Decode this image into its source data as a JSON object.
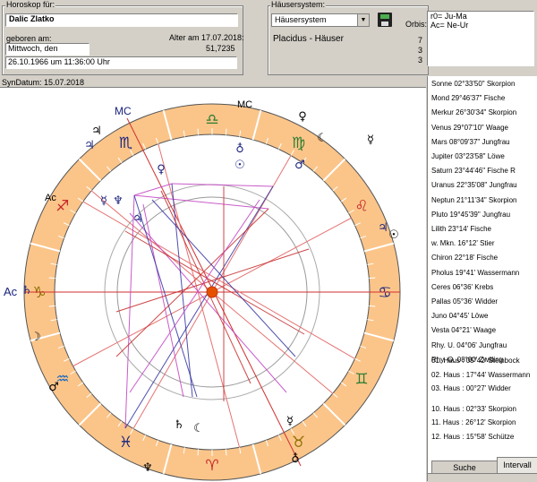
{
  "horoscope": {
    "title": "Horoskop für:",
    "name": "Dalic Zlatko",
    "born_label": "geboren am:",
    "age_label": "Alter am 17.07.2018:",
    "weekday": "Mittwoch, den",
    "age_value": "51,7235",
    "datetime": "26.10.1966  um  11:36:00 Uhr"
  },
  "houses": {
    "title": "Häusersystem:",
    "select_value": "Häusersystem",
    "system_name": "Placidus - Häuser",
    "orbis_label": "Orbis:",
    "orbis_lines": [
      "r0= Ju-Ma",
      "Ac= Ne-Ur"
    ],
    "numbers": [
      "7",
      "3",
      "3"
    ]
  },
  "syn_date": "SynDatum: 15.07.2018",
  "planets": [
    "Sonne    02°33'50\" Skorpion",
    "Mond     29°46'37\" Fische",
    "Merkur   26°30'34\" Skorpion",
    "Venus    29°07'10\" Waage",
    "Mars     08°09'37\" Jungfrau",
    "Jupiter  03°23'58\" Löwe",
    "Saturn   23°44'46\" Fische R",
    "Uranus   22°35'08\" Jungfrau",
    "Neptun   21°11'34\" Skorpion",
    "Pluto    19°45'39\" Jungfrau",
    "Lilith  23°14' Fische",
    "w. Mkn.  16°12' Stier",
    "Chiron   22°18' Fische",
    "Pholus   19°41' Wassermann",
    "Ceres    06°36' Krebs",
    "Pallas   05°36' Widder",
    "Juno     04°45' Löwe",
    "Vesta    04°21' Waage",
    "Rhy. U.    04°06' Jungfrau",
    "Rhy. O.    08°00' Zwilling"
  ],
  "house_cusps": [
    "01. Haus :  05°42' Steinbock",
    "02. Haus :  17°44' Wassermann",
    "03. Haus :  00°27' Widder",
    "10. Haus :  02°33' Skorpion",
    "11. Haus :  26°12' Skorpion",
    "12. Haus :  15°58' Schütze"
  ],
  "tabs": {
    "search": "Suche",
    "interval": "Intervall"
  },
  "chart_labels": {
    "mc": "MC",
    "ac": "Ac"
  },
  "colors": {
    "zodiac_ring": "#fbc58a",
    "planet_blue": "#1a237e",
    "aspect_red": "#c62828",
    "aspect_magenta": "#c040c0",
    "aspect_blue": "#3030a0"
  }
}
